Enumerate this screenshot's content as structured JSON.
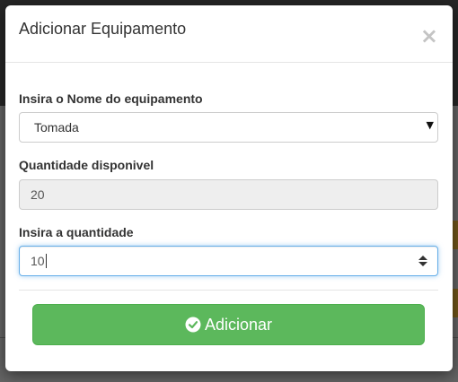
{
  "modal": {
    "title": "Adicionar Equipamento",
    "close_symbol": "×"
  },
  "form": {
    "name_label": "Insira o Nome do equipamento",
    "name_selected": "Tomada",
    "available_label": "Quantidade disponivel",
    "available_value": "20",
    "quantity_label": "Insira a quantidade",
    "quantity_value": "10"
  },
  "submit": {
    "label": "Adicionar",
    "icon": "check-circle-icon",
    "color": "#5cb85c"
  }
}
